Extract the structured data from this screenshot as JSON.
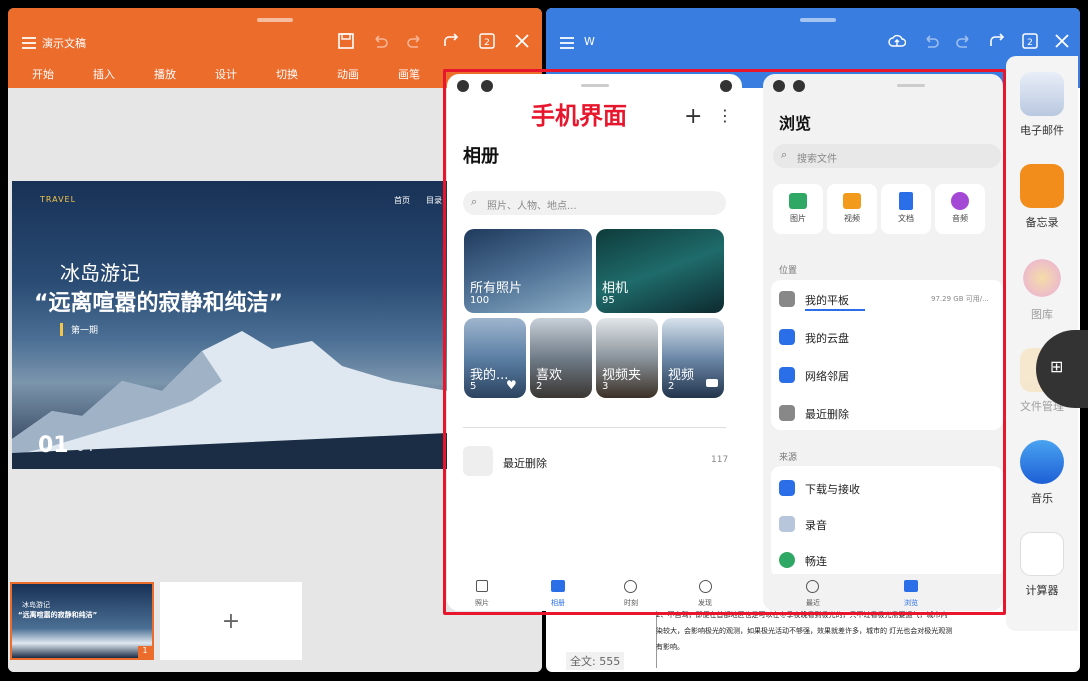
{
  "left_window": {
    "title": "演示文稿",
    "menu": [
      "开始",
      "插入",
      "播放",
      "设计",
      "切换",
      "动画",
      "画笔"
    ],
    "slide": {
      "tag": "TRAVEL",
      "nav": [
        "首页",
        "目录"
      ],
      "line1": "冰岛游记",
      "line2": "“远离喧嚣的寂静和纯洁”",
      "badge": "第一期",
      "page_current": "01",
      "page_total": "04"
    },
    "thumb": {
      "line1": "冰岛游记",
      "line2": "“远离喧嚣的寂静和纯洁”",
      "index": "1"
    },
    "add_slide": "+"
  },
  "right_window": {
    "title": "W",
    "word_count_label": "全文: 555",
    "doc_text": [
      "2、不自驾，即便在首都地区也是可以在冬季夜晚看到极光的，只不过看极光需要运气，城市内",
      "染较大，会影响极光的观测，如果极光活动不够强，效果就差许多，城市的 灯光也会对极光观测",
      "有影响。"
    ]
  },
  "annotation": "手机界面",
  "gallery": {
    "title": "相册",
    "search_placeholder": "照片、人物、地点...",
    "albums": [
      {
        "name": "所有照片",
        "count": "100"
      },
      {
        "name": "相机",
        "count": "95"
      },
      {
        "name": "我的...",
        "count": "5"
      },
      {
        "name": "喜欢",
        "count": "2"
      },
      {
        "name": "视频夹",
        "count": "3"
      },
      {
        "name": "视频",
        "count": "2"
      }
    ],
    "recent_deleted": {
      "label": "最近删除",
      "count": "117"
    },
    "tabs": [
      "照片",
      "相册",
      "时刻",
      "发现"
    ],
    "active_tab": "相册"
  },
  "files": {
    "title": "浏览",
    "search_placeholder": "搜索文件",
    "categories": [
      "图片",
      "视频",
      "文档",
      "音频"
    ],
    "location_header": "位置",
    "locations": [
      {
        "name": "我的平板",
        "meta": "97.29 GB 可用/..."
      },
      {
        "name": "我的云盘",
        "meta": ""
      },
      {
        "name": "网络邻居",
        "meta": ""
      },
      {
        "name": "最近删除",
        "meta": ""
      }
    ],
    "source_header": "来源",
    "sources": [
      "下载与接收",
      "录音",
      "畅连"
    ],
    "tabs": [
      "最近",
      "浏览"
    ],
    "active_tab": "浏览"
  },
  "dock": {
    "items": [
      "电子邮件",
      "备忘录",
      "图库",
      "文件管理",
      "音乐",
      "计算器"
    ]
  },
  "colors": {
    "presentation_orange": "#ec6c2c",
    "writer_blue": "#3a7de0",
    "annotation_red": "#e8162c",
    "accent_blue": "#2a6fe8"
  }
}
